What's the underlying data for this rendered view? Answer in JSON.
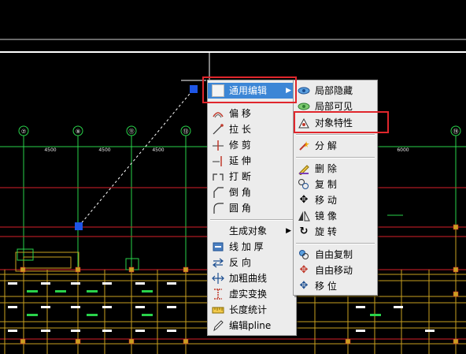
{
  "drawing": {
    "axis_numbers": [
      "⑦",
      "⑨",
      "⑪",
      "⑬",
      "⑲"
    ],
    "dimensions": [
      "4500",
      "4500",
      "4500",
      "6000"
    ],
    "colors": {
      "background": "#000000",
      "axis": "#29d24a",
      "beam": "#c8a020",
      "grip": "#1e56e6",
      "red_line": "#d8212a"
    }
  },
  "menu_main": {
    "items": [
      {
        "label": "通用编辑",
        "icon": "blank-icon",
        "submenu": true,
        "highlighted": true
      },
      {
        "label": "偏 移",
        "icon": "offset-icon"
      },
      {
        "label": "拉 长",
        "icon": "lengthen-icon"
      },
      {
        "label": "修 剪",
        "icon": "trim-icon"
      },
      {
        "label": "延 伸",
        "icon": "extend-icon"
      },
      {
        "label": "打 断",
        "icon": "break-icon"
      },
      {
        "label": "倒 角",
        "icon": "chamfer-icon"
      },
      {
        "label": "圆 角",
        "icon": "fillet-icon"
      },
      {
        "label": "生成对象",
        "icon": "",
        "submenu": true
      },
      {
        "label": "线 加 厚",
        "icon": "thicken-icon"
      },
      {
        "label": "反 向",
        "icon": "reverse-icon"
      },
      {
        "label": "加粗曲线",
        "icon": "bold-curve-icon"
      },
      {
        "label": "虚实变换",
        "icon": "dash-solid-icon"
      },
      {
        "label": "长度统计",
        "icon": "ruler-icon"
      },
      {
        "label": "编辑pline",
        "icon": "pencil-icon"
      }
    ]
  },
  "menu_sub": {
    "items": [
      {
        "label": "局部隐藏",
        "icon": "eye-hide-icon"
      },
      {
        "label": "局部可见",
        "icon": "eye-show-icon"
      },
      {
        "label": "对象特性",
        "icon": "properties-icon"
      },
      {
        "label": "分 解",
        "icon": "explode-icon"
      },
      {
        "label": "删 除",
        "icon": "erase-icon"
      },
      {
        "label": "复 制",
        "icon": "copy-icon"
      },
      {
        "label": "移 动",
        "icon": "move-icon"
      },
      {
        "label": "镜 像",
        "icon": "mirror-icon"
      },
      {
        "label": "旋 转",
        "icon": "rotate-icon"
      },
      {
        "label": "自由复制",
        "icon": "free-copy-icon"
      },
      {
        "label": "自由移动",
        "icon": "free-move-icon"
      },
      {
        "label": "移 位",
        "icon": "shift-icon"
      }
    ]
  }
}
